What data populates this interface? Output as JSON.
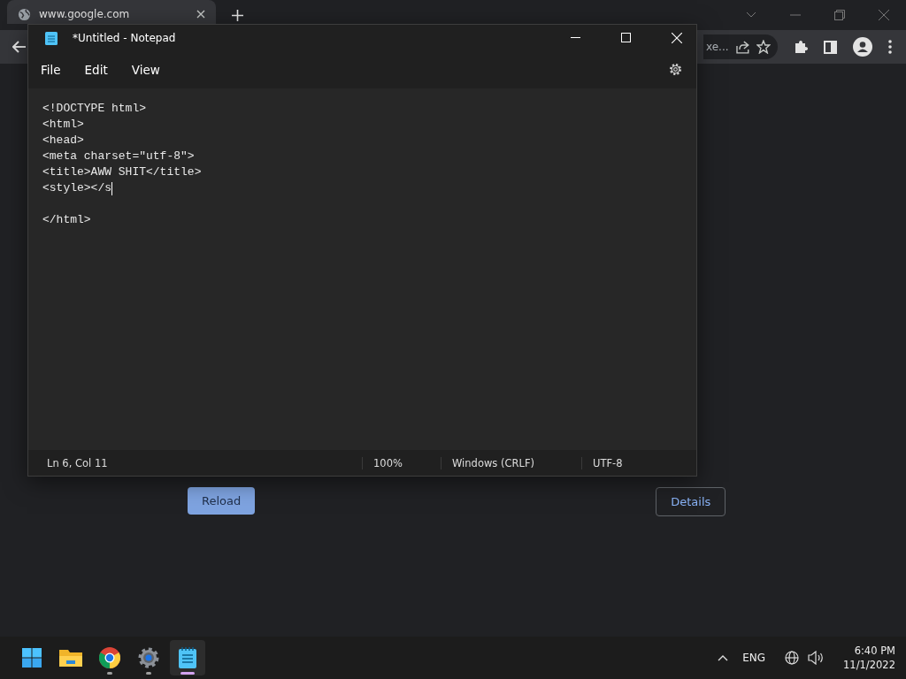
{
  "browser": {
    "tab": {
      "title": "www.google.com",
      "selected": true
    },
    "address_fragment": "xe...",
    "buttons": [
      {
        "label": "Reload",
        "kind": "primary"
      },
      {
        "label": "Details",
        "kind": "outline"
      }
    ]
  },
  "notepad": {
    "title": "*Untitled - Notepad",
    "menu": [
      "File",
      "Edit",
      "View"
    ],
    "lines": [
      {
        "text": "<!DOCTYPE html>",
        "cursor": false
      },
      {
        "text": "<html>",
        "cursor": false
      },
      {
        "text": "<head>",
        "cursor": false
      },
      {
        "text": "<meta charset=\"utf-8\">",
        "cursor": false
      },
      {
        "text": "<title>AWW SHIT</title>",
        "cursor": false
      },
      {
        "text": "<style></s",
        "cursor": true
      }
    ],
    "lines_after_blank": [
      "</html>"
    ],
    "status_bar": [
      "Ln 6, Col 11",
      "100%",
      "Windows (CRLF)",
      "UTF-8"
    ]
  },
  "taskbar": {
    "apps": [
      {
        "kind": "start",
        "running": false,
        "selected": false
      },
      {
        "kind": "folder",
        "running": false,
        "selected": false
      },
      {
        "kind": "browser",
        "running": true,
        "selected": false
      },
      {
        "kind": "settings",
        "running": true,
        "selected": false
      },
      {
        "kind": "notepad",
        "running": true,
        "selected": true
      }
    ],
    "language": "ENG",
    "time": "6:40 PM",
    "date": "11/1/2022"
  }
}
